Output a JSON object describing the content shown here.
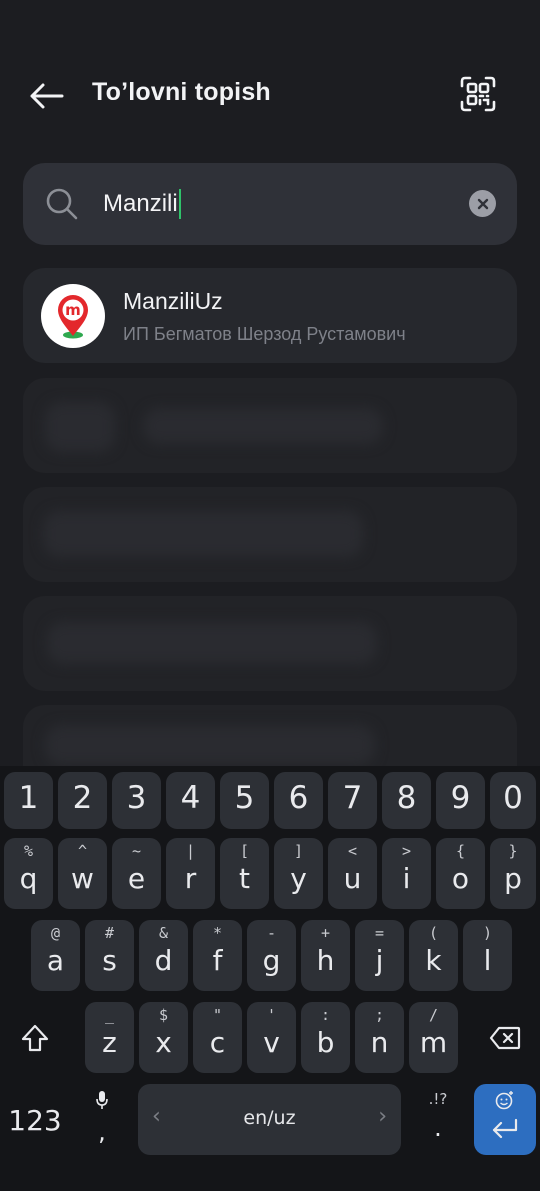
{
  "header": {
    "title": "To’lovni topish"
  },
  "search": {
    "value": "Manzili"
  },
  "result": {
    "name": "ManziliUz",
    "subtitle": "ИП Бегматов Шерзод Рустамович",
    "logo_letter": "m"
  },
  "keyboard": {
    "numbers": [
      "1",
      "2",
      "3",
      "4",
      "5",
      "6",
      "7",
      "8",
      "9",
      "0"
    ],
    "row1": [
      {
        "hint": "%",
        "key": "q"
      },
      {
        "hint": "^",
        "key": "w"
      },
      {
        "hint": "~",
        "key": "e"
      },
      {
        "hint": "|",
        "key": "r"
      },
      {
        "hint": "[",
        "key": "t"
      },
      {
        "hint": "]",
        "key": "y"
      },
      {
        "hint": "<",
        "key": "u"
      },
      {
        "hint": ">",
        "key": "i"
      },
      {
        "hint": "{",
        "key": "o"
      },
      {
        "hint": "}",
        "key": "p"
      }
    ],
    "row2": [
      {
        "hint": "@",
        "key": "a"
      },
      {
        "hint": "#",
        "key": "s"
      },
      {
        "hint": "&",
        "key": "d"
      },
      {
        "hint": "*",
        "key": "f"
      },
      {
        "hint": "-",
        "key": "g"
      },
      {
        "hint": "+",
        "key": "h"
      },
      {
        "hint": "=",
        "key": "j"
      },
      {
        "hint": "(",
        "key": "k"
      },
      {
        "hint": ")",
        "key": "l"
      }
    ],
    "row3": [
      {
        "hint": "_",
        "key": "z"
      },
      {
        "hint": "$",
        "key": "x"
      },
      {
        "hint": "\"",
        "key": "c"
      },
      {
        "hint": "'",
        "key": "v"
      },
      {
        "hint": ":",
        "key": "b"
      },
      {
        "hint": ";",
        "key": "n"
      },
      {
        "hint": "/",
        "key": "m"
      }
    ],
    "symbols_key": "123",
    "comma_key": ",",
    "language": "en/uz",
    "period_hint": ".!?",
    "period_key": ".",
    "accent_color": "#2d6ec0"
  }
}
